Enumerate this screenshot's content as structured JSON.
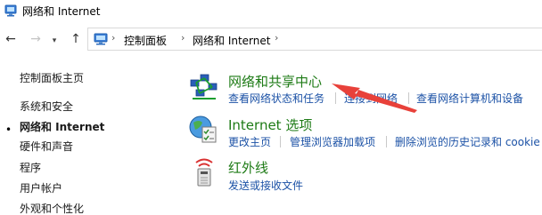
{
  "window": {
    "title": "网络和 Internet",
    "app_icon": "control-panel-icon"
  },
  "nav": {
    "back_icon": "back-arrow-icon",
    "forward_icon": "forward-arrow-icon",
    "history_icon": "chevron-down-icon",
    "up_icon": "up-arrow-icon",
    "breadcrumb": [
      "控制面板",
      "网络和 Internet"
    ],
    "separator": "›"
  },
  "sidebar": {
    "items": [
      {
        "label": "控制面板主页"
      },
      {
        "label": "系统和安全"
      },
      {
        "label": "网络和 Internet",
        "current": true
      },
      {
        "label": "硬件和声音"
      },
      {
        "label": "程序"
      },
      {
        "label": "用户帐户"
      },
      {
        "label": "外观和个性化"
      }
    ],
    "current_marker": "•"
  },
  "categories": [
    {
      "title": "网络和共享中心",
      "icon": "network-sharing-center-icon",
      "links": [
        "查看网络状态和任务",
        "连接到网络",
        "查看网络计算机和设备"
      ]
    },
    {
      "title": "Internet 选项",
      "icon": "internet-options-icon",
      "links": [
        "更改主页",
        "管理浏览器加载项",
        "删除浏览的历史记录和 cookie"
      ]
    },
    {
      "title": "红外线",
      "icon": "infrared-icon",
      "links": [
        "发送或接收文件"
      ]
    }
  ],
  "annotation": {
    "icon": "red-arrow-annotation",
    "color": "#e8413a"
  },
  "colors": {
    "category_title": "#1e7b16",
    "link": "#1c52a6"
  }
}
